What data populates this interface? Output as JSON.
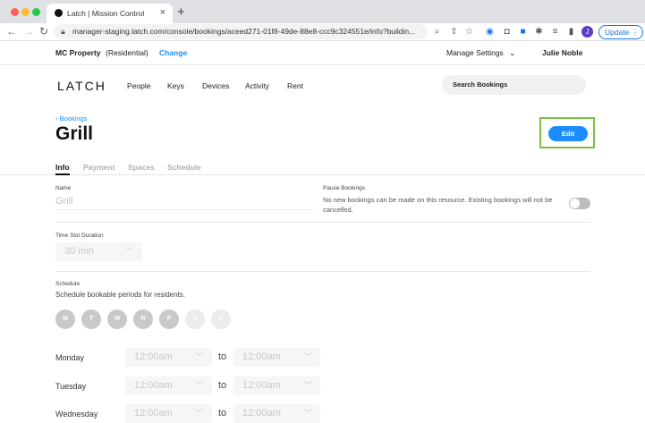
{
  "browser": {
    "tab_title": "Latch | Mission Control",
    "url": "manager-staging.latch.com/console/bookings/aceed271-01f8-49de-88e8-ccc9c324551e/info?buildin...",
    "update_label": "Update",
    "profile_initial": "J"
  },
  "propbar": {
    "property_name": "MC Property",
    "property_type": "(Residential)",
    "change_label": "Change",
    "manage_settings": "Manage Settings",
    "user_name": "Julie Noble"
  },
  "nav": {
    "logo": "LATCH",
    "items": [
      "People",
      "Keys",
      "Devices",
      "Activity",
      "Rent"
    ],
    "search_label": "Search Bookings"
  },
  "page": {
    "breadcrumb": "Bookings",
    "title": "Grill",
    "edit_label": "Edit",
    "tabs": [
      "Info",
      "Payment",
      "Spaces",
      "Schedule"
    ]
  },
  "form": {
    "name_label": "Name",
    "name_value": "Grill",
    "pause_label": "Pause Bookings",
    "pause_desc": "No new bookings can be made on this resource. Existing bookings will not be cancelled.",
    "slot_label": "Time Slot Duration",
    "slot_value": "30 min",
    "schedule_label": "Schedule",
    "schedule_desc": "Schedule bookable periods for residents.",
    "days": [
      "M",
      "T",
      "W",
      "R",
      "F",
      "S",
      "S"
    ],
    "rows": [
      {
        "day": "Monday",
        "from": "12:00am",
        "to": "12:00am"
      },
      {
        "day": "Tuesday",
        "from": "12:00am",
        "to": "12:00am"
      },
      {
        "day": "Wednesday",
        "from": "12:00am",
        "to": "12:00am"
      }
    ],
    "to_word": "to"
  },
  "colors": {
    "accent": "#1a8cff",
    "highlight": "#7ac142",
    "day_active": "#c9c9c9",
    "day_inactive": "#ebebeb"
  }
}
